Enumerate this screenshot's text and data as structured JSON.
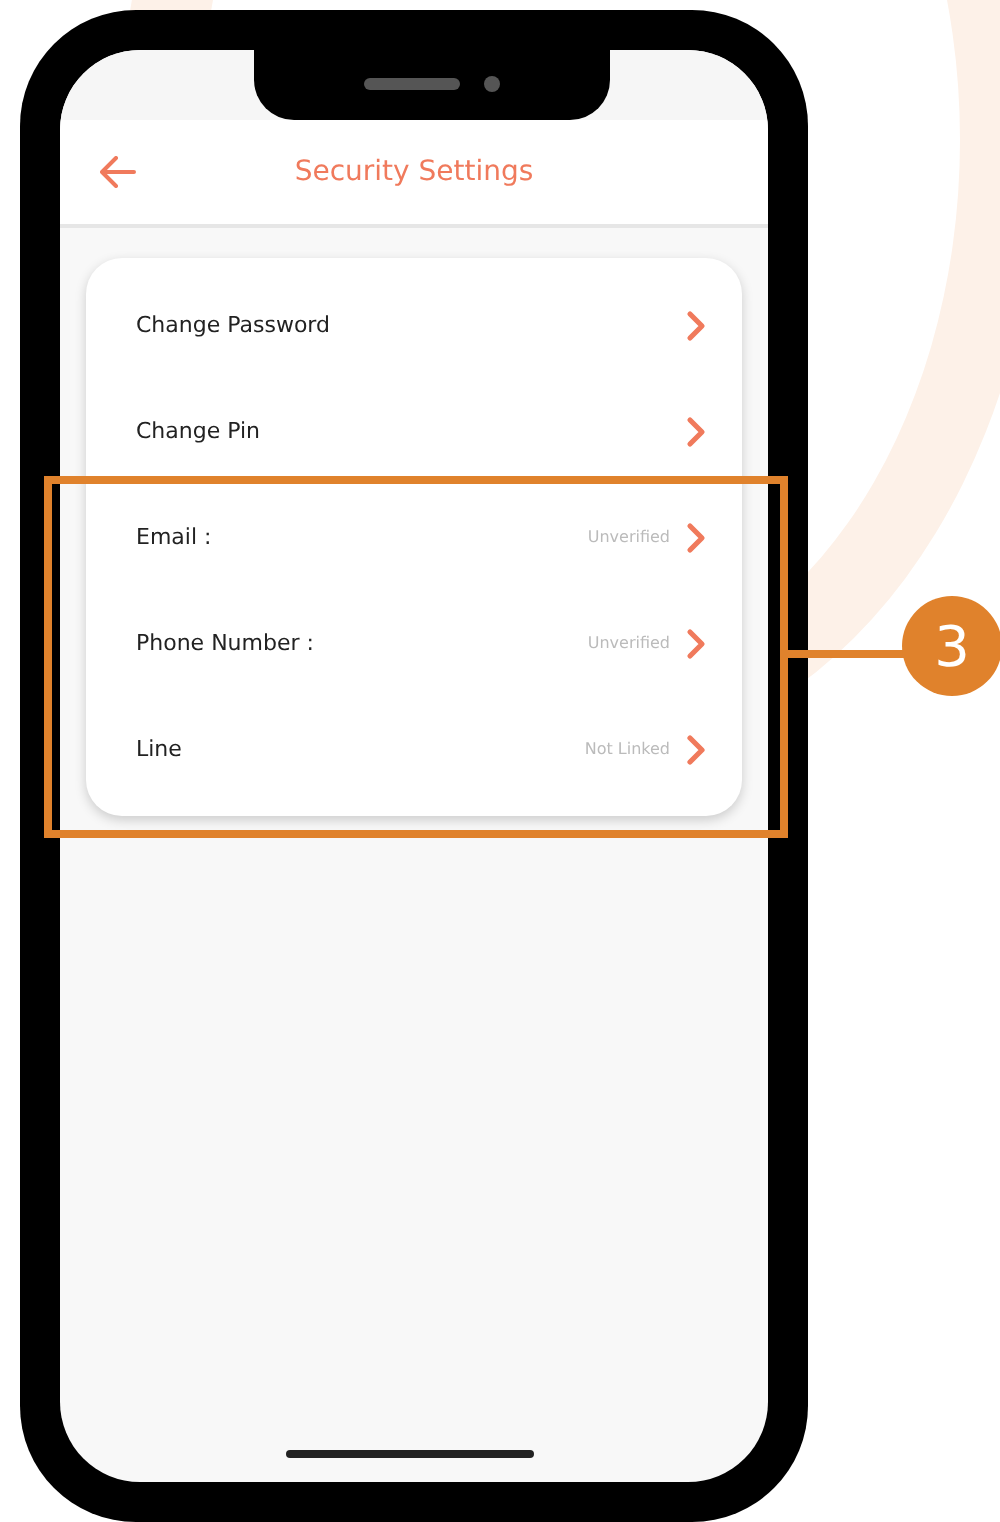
{
  "header": {
    "title": "Security Settings"
  },
  "rows": [
    {
      "label": "Change Password"
    },
    {
      "label": "Change Pin"
    },
    {
      "label": "Email :",
      "status": "Unverified"
    },
    {
      "label": "Phone Number :",
      "status": "Unverified"
    },
    {
      "label": "Line",
      "status": "Not Linked"
    }
  ],
  "callout": {
    "number": "3"
  }
}
